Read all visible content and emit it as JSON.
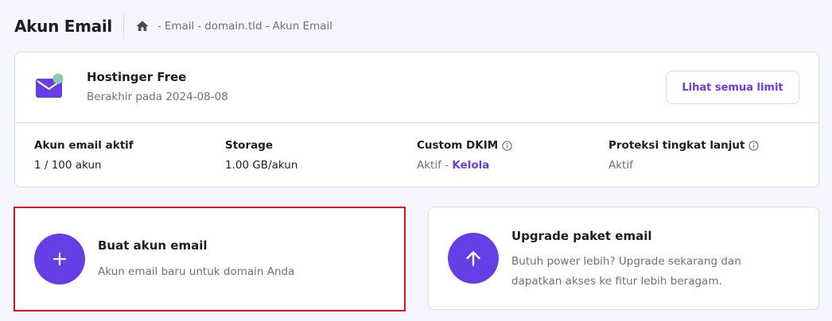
{
  "header": {
    "title": "Akun Email",
    "breadcrumb": [
      "Email",
      "domain.tld",
      "Akun Email"
    ],
    "separator": "-"
  },
  "plan": {
    "name": "Hostinger Free",
    "expiry": "Berakhir pada 2024-08-08",
    "limits_button": "Lihat semua limit",
    "icon": "mail-icon"
  },
  "stats": [
    {
      "label": "Akun email aktif",
      "value": "1 / 100 akun"
    },
    {
      "label": "Storage",
      "value": "1.00 GB/akun"
    },
    {
      "label": "Custom DKIM",
      "value": "Aktif",
      "link": "Kelola",
      "joiner": " - "
    },
    {
      "label": "Proteksi tingkat lanjut",
      "value": "Aktif"
    }
  ],
  "actions": {
    "create": {
      "title": "Buat akun email",
      "description": "Akun email baru untuk domain Anda",
      "icon": "plus-icon"
    },
    "upgrade": {
      "title": "Upgrade paket email",
      "description": "Butuh power lebih? Upgrade sekarang dan dapatkan akses ke fitur lebih beragam.",
      "icon": "arrow-up-icon"
    }
  },
  "colors": {
    "accent": "#673de6",
    "highlight": "#e0111c",
    "background": "#f4f5ff"
  }
}
